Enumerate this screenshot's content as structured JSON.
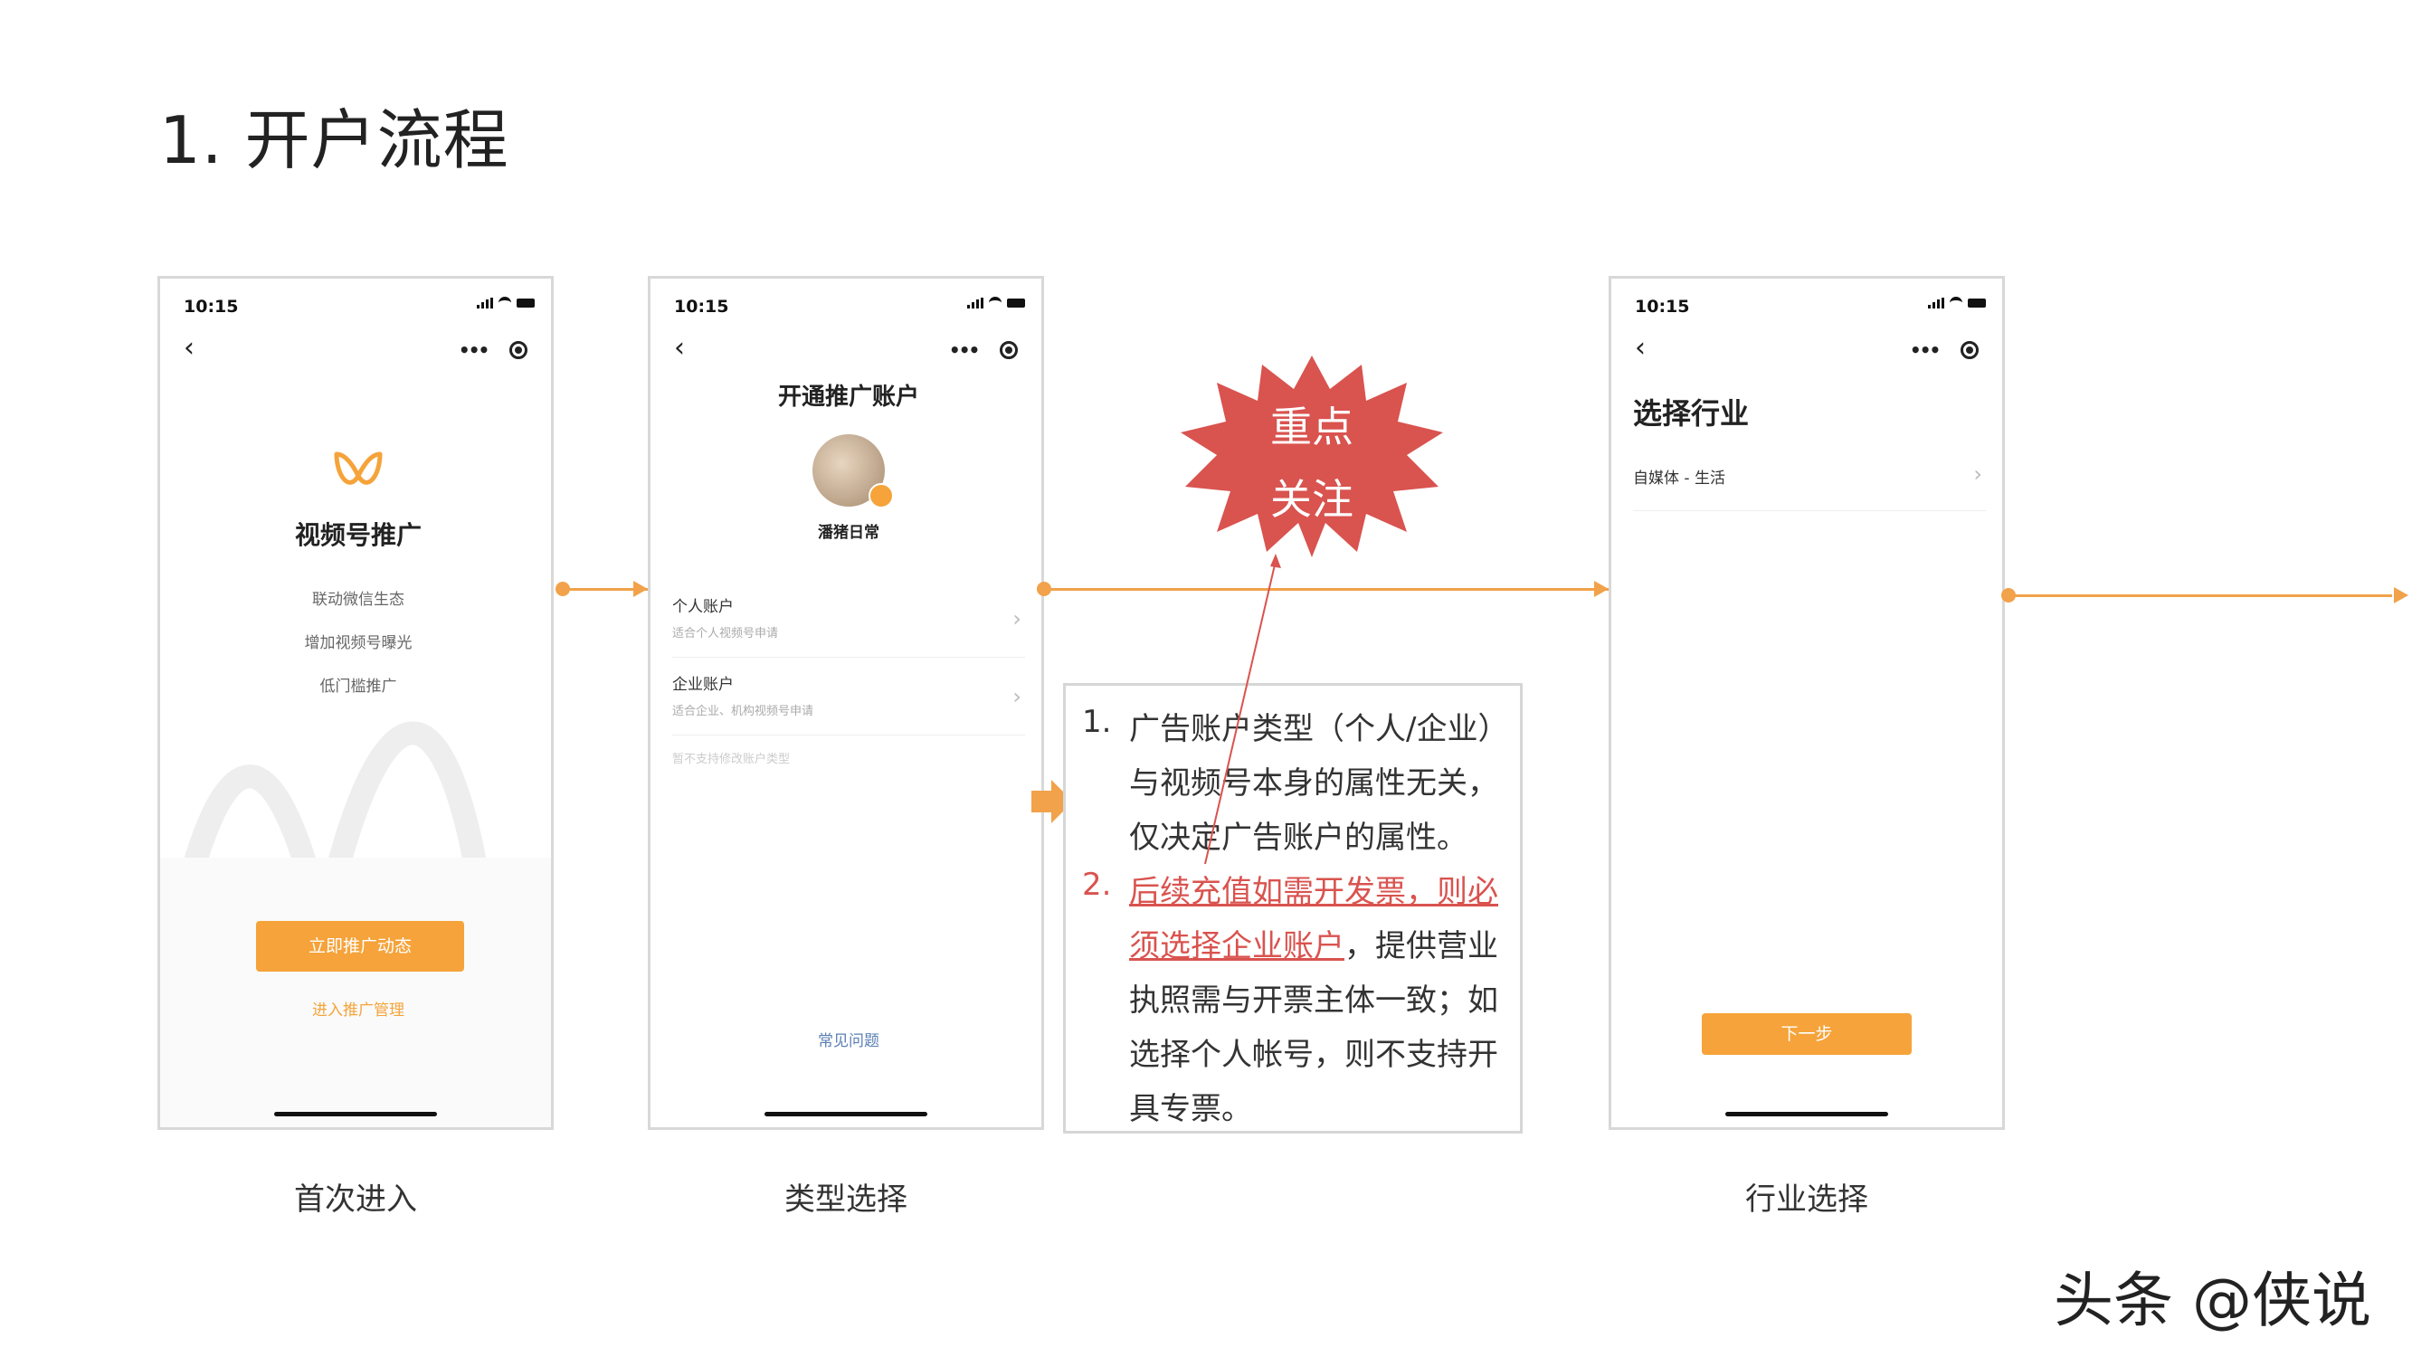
{
  "title": "1. 开户流程",
  "phones": {
    "p1": {
      "time": "10:15",
      "brand": "视频号推广",
      "features": [
        "联动微信生态",
        "增加视频号曝光",
        "低门槛推广"
      ],
      "primary_btn": "立即推广动态",
      "link": "进入推广管理"
    },
    "p2": {
      "time": "10:15",
      "heading": "开通推广账户",
      "username": "潘猪日常",
      "options": [
        {
          "label": "个人账户",
          "desc": "适合个人视频号申请"
        },
        {
          "label": "企业账户",
          "desc": "适合企业、机构视频号申请"
        }
      ],
      "hint": "暂不支持修改账户类型",
      "faq": "常见问题"
    },
    "p3": {
      "time": "10:15",
      "heading": "选择行业",
      "industry": "自媒体 - 生活",
      "next_btn": "下一步"
    }
  },
  "burst": {
    "line1": "重点",
    "line2": "关注"
  },
  "notes": {
    "n1_num": "1.",
    "n1_l1": "广告账户类型（个人/企业）",
    "n1_l2": "与视频号本身的属性无关，",
    "n1_l3": "仅决定广告账户的属性。",
    "n2_num": "2.",
    "n2_l1": "后续充值如需开发票，则必",
    "n2_l2_red": "须选择企业账户",
    "n2_l2_rest": "，提供营业",
    "n2_l3": "执照需与开票主体一致；如",
    "n2_l4": "选择个人帐号，则不支持开",
    "n2_l5": "具专票。"
  },
  "captions": [
    "首次进入",
    "类型选择",
    "行业选择"
  ],
  "watermark": "头条 @侠说",
  "colors": {
    "orange": "#f5a33a",
    "arrow": "#f1a24a",
    "red": "#d9534f",
    "burst": "#d9534f"
  }
}
